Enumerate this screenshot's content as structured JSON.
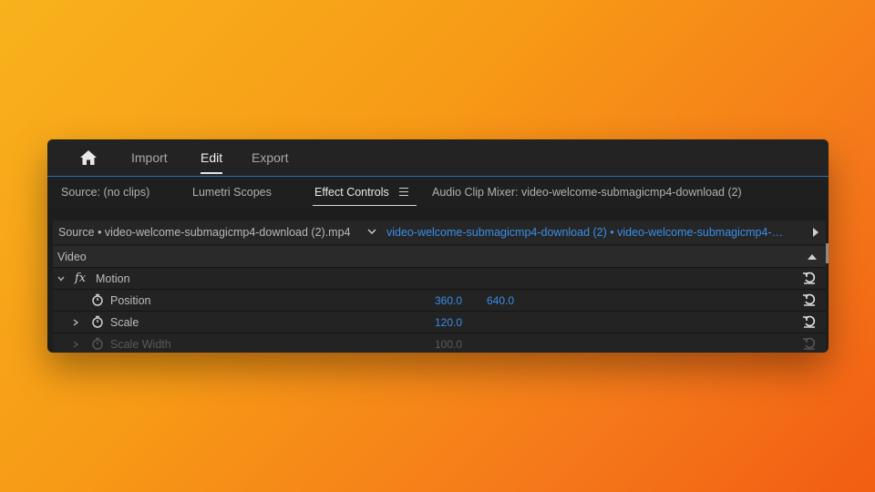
{
  "topbar": {
    "home_icon": "home-icon",
    "tabs": [
      {
        "label": "Import",
        "active": false
      },
      {
        "label": "Edit",
        "active": true
      },
      {
        "label": "Export",
        "active": false
      }
    ]
  },
  "panel_tabs": [
    {
      "label": "Source: (no clips)"
    },
    {
      "label": "Lumetri Scopes"
    },
    {
      "label": "Effect Controls",
      "active": true
    },
    {
      "label": "Audio Clip Mixer: video-welcome-submagicmp4-download (2)"
    }
  ],
  "source_bar": {
    "source_label": "Source • video-welcome-submagicmp4-download (2).mp4",
    "sequence_label": "video-welcome-submagicmp4-download (2) • video-welcome-submagicmp4-…"
  },
  "effects": {
    "section_label": "Video",
    "motion_label": "Motion",
    "fx_label": "fx",
    "properties": [
      {
        "label": "Position",
        "value1": "360.0",
        "value2": "640.0",
        "enabled": true
      },
      {
        "label": "Scale",
        "value1": "120.0",
        "value2": "",
        "enabled": true
      },
      {
        "label": "Scale Width",
        "value1": "100.0",
        "value2": "",
        "enabled": false
      }
    ]
  },
  "colors": {
    "accent": "#3a8ee6",
    "panel_bg": "#1d1d1d",
    "background_gradient_start": "#f8b21c",
    "background_gradient_end": "#f25d12"
  }
}
